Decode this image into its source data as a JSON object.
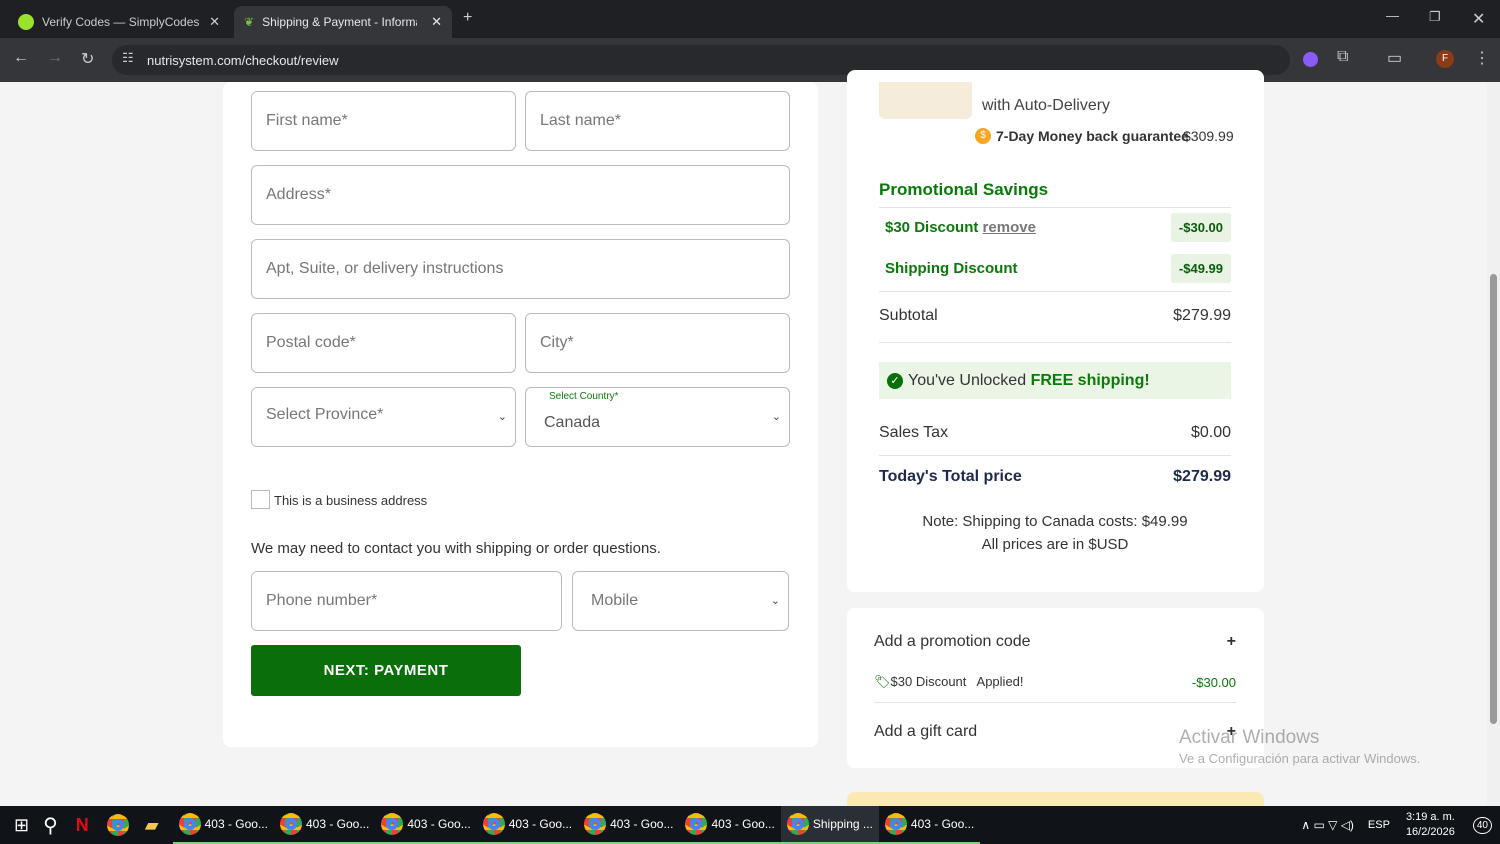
{
  "browser": {
    "tabs": [
      {
        "title": "Verify Codes — SimplyCodes"
      },
      {
        "title": "Shipping & Payment - Informat"
      }
    ],
    "url": "nutrisystem.com/checkout/review",
    "profile": "F"
  },
  "form": {
    "first_name": "First name*",
    "last_name": "Last name*",
    "address": "Address*",
    "apt": "Apt, Suite, or delivery instructions",
    "postal": "Postal code*",
    "city": "City*",
    "province": "Select Province*",
    "country_label": "Select Country*",
    "country": "Canada",
    "business": "This is a business address",
    "contact_note": "We may need to contact you with shipping or order questions.",
    "phone": "Phone number*",
    "phone_type": "Mobile",
    "next": "NEXT: PAYMENT"
  },
  "summary": {
    "product_sub": "with Auto-Delivery",
    "guarantee": "7-Day Money back guarantee",
    "product_price": "$309.99",
    "promo_title": "Promotional Savings",
    "discount_label": "$30 Discount",
    "remove": "remove",
    "discount_value": "-$30.00",
    "shipping_label": "Shipping Discount",
    "shipping_value": "-$49.99",
    "subtotal_label": "Subtotal",
    "subtotal": "$279.99",
    "free_pre": "You've Unlocked ",
    "free_bold": "FREE shipping!",
    "tax_label": "Sales Tax",
    "tax": "$0.00",
    "total_label": "Today's Total price",
    "total": "$279.99",
    "note1": "Note: Shipping to Canada costs: $49.99",
    "note2": "All prices are in $USD"
  },
  "promo": {
    "add_promo": "Add a promotion code",
    "applied_name": "$30 Discount",
    "applied": "Applied!",
    "applied_value": "-$30.00",
    "gift": "Add a gift card"
  },
  "watermark": {
    "title": "Activar Windows",
    "sub": "Ve a Configuración para activar Windows."
  },
  "taskbar": {
    "items": [
      "403 - Goo...",
      "403 - Goo...",
      "403 - Goo...",
      "403 - Goo...",
      "403 - Goo...",
      "403 - Goo...",
      "Shipping ...",
      "403 - Goo..."
    ],
    "lang": "ESP",
    "time": "3:19 a. m.",
    "date": "16/2/2026",
    "notif": "40"
  }
}
